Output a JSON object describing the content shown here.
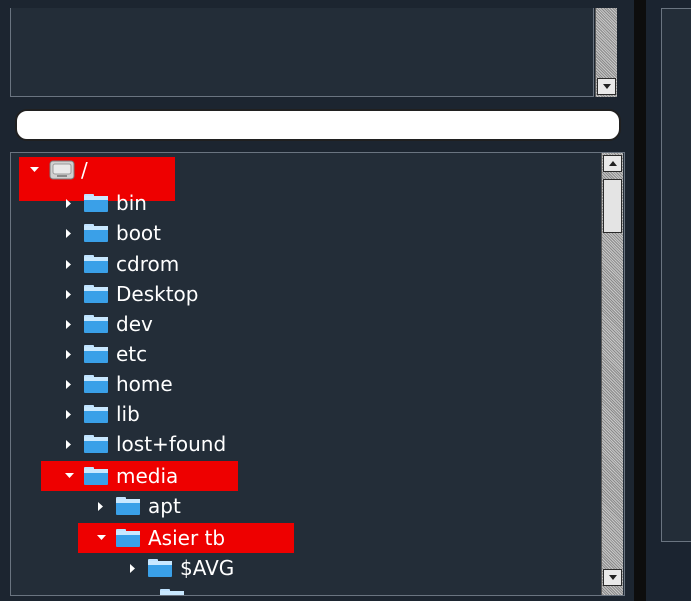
{
  "search": {
    "value": "",
    "placeholder": ""
  },
  "tree": {
    "root_label": "/",
    "items": [
      {
        "label": "bin"
      },
      {
        "label": "boot"
      },
      {
        "label": "cdrom"
      },
      {
        "label": "Desktop"
      },
      {
        "label": "dev"
      },
      {
        "label": "etc"
      },
      {
        "label": "home"
      },
      {
        "label": "lib"
      },
      {
        "label": "lost+found"
      },
      {
        "label": "media"
      }
    ],
    "media_children": [
      {
        "label": "apt"
      },
      {
        "label": "Asier tb"
      }
    ],
    "asier_children": [
      {
        "label": "$AVG"
      }
    ]
  },
  "colors": {
    "highlight": "#ee0000",
    "panel_bg": "#232d38",
    "folder_blue": "#3aa0e8",
    "text": "#ffffff"
  },
  "icons": [
    "drive-icon",
    "folder-icon",
    "expander-arrow-icon",
    "scroll-up-icon",
    "scroll-down-icon"
  ]
}
